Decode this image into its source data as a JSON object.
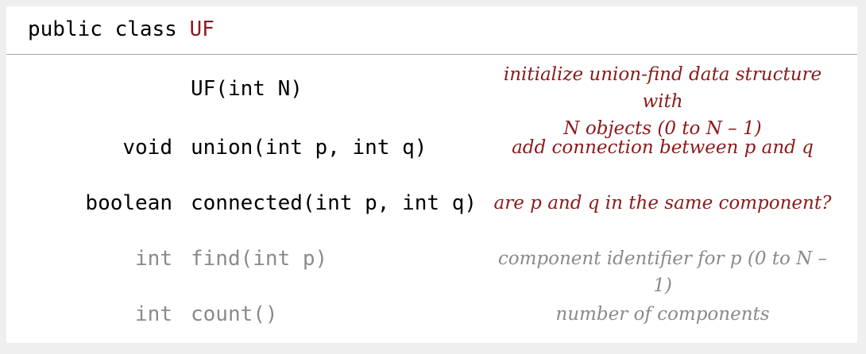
{
  "header": {
    "prefix": "public class",
    "class_name": "UF"
  },
  "api": [
    {
      "return_type": "",
      "signature": "UF(int N)",
      "description_line1": "initialize union-find data structure with",
      "description_line2": "N objects (0 to N – 1)"
    },
    {
      "return_type": "void",
      "signature": "union(int p, int q)",
      "description": "add connection between p and q"
    },
    {
      "return_type": "boolean",
      "signature": "connected(int p, int q)",
      "description": "are p and q in the same component?"
    },
    {
      "return_type": "int",
      "signature": "find(int p)",
      "description": "component identifier for p (0 to N – 1)"
    },
    {
      "return_type": "int",
      "signature": "count()",
      "description": "number of components"
    }
  ],
  "colors": {
    "accent": "#8b1a1a",
    "muted": "#8a8a8a",
    "text": "#000000",
    "background": "#efefef",
    "panel": "#ffffff",
    "divider": "#a8a8a8"
  }
}
